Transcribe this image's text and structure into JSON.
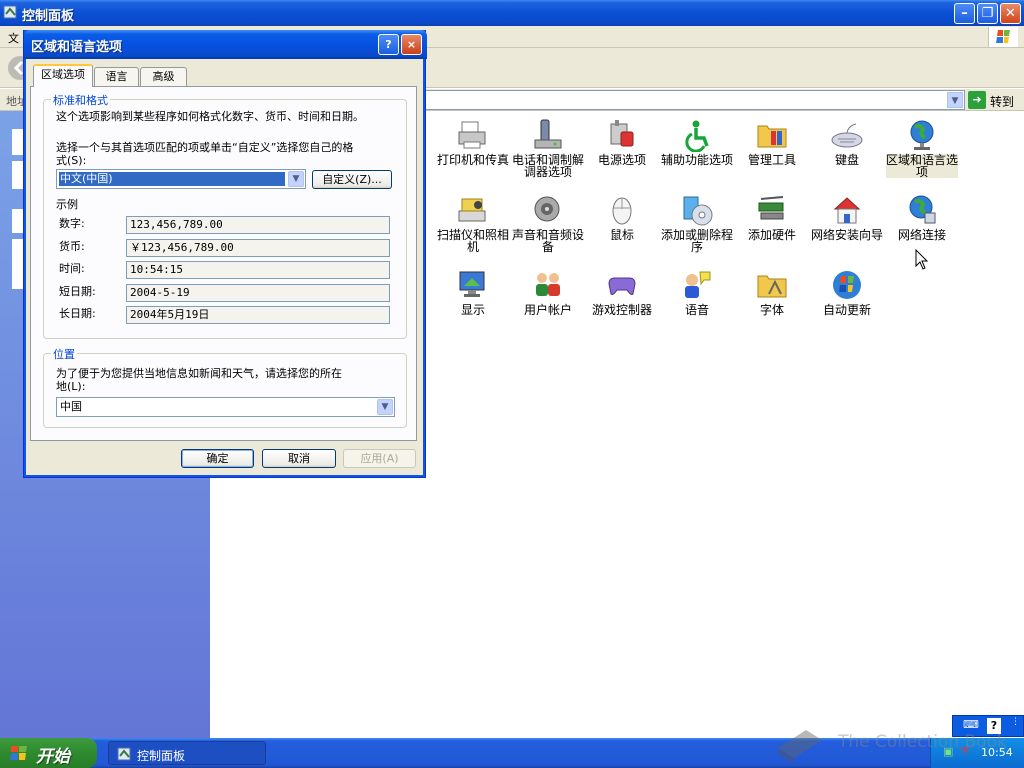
{
  "window": {
    "title": "控制面板"
  },
  "menubar": {
    "file": "文"
  },
  "addressbar": {
    "label": "地址",
    "go_label": "转到"
  },
  "control_panel_items": [
    {
      "label": "打印机和传真",
      "icon": "printer-icon"
    },
    {
      "label": "电话和调制解调器选项",
      "icon": "phone-modem-icon"
    },
    {
      "label": "电源选项",
      "icon": "power-options-icon"
    },
    {
      "label": "辅助功能选项",
      "icon": "accessibility-icon"
    },
    {
      "label": "管理工具",
      "icon": "admin-tools-icon"
    },
    {
      "label": "键盘",
      "icon": "keyboard-icon"
    },
    {
      "label": "区域和语言选项",
      "icon": "globe-icon"
    },
    {
      "label": "扫描仪和照相机",
      "icon": "scanner-icon"
    },
    {
      "label": "声音和音频设备",
      "icon": "speaker-icon"
    },
    {
      "label": "鼠标",
      "icon": "mouse-icon"
    },
    {
      "label": "添加或删除程序",
      "icon": "add-remove-icon"
    },
    {
      "label": "添加硬件",
      "icon": "add-hardware-icon"
    },
    {
      "label": "网络安装向导",
      "icon": "network-wizard-icon"
    },
    {
      "label": "网络连接",
      "icon": "network-connections-icon"
    },
    {
      "label": "显示",
      "icon": "display-icon"
    },
    {
      "label": "用户帐户",
      "icon": "user-accounts-icon"
    },
    {
      "label": "游戏控制器",
      "icon": "game-controller-icon"
    },
    {
      "label": "语音",
      "icon": "speech-icon"
    },
    {
      "label": "字体",
      "icon": "fonts-icon"
    },
    {
      "label": "自动更新",
      "icon": "windows-update-icon"
    }
  ],
  "dialog": {
    "title": "区域和语言选项",
    "help": "?",
    "close": "×",
    "tabs": [
      "区域选项",
      "语言",
      "高级"
    ],
    "standards": {
      "group_title": "标准和格式",
      "desc": "这个选项影响到某些程序如何格式化数字、货币、时间和日期。",
      "select_text_1": "选择一个与其首选项匹配的项或单击“自定义”选择您自己的格",
      "select_text_2": "式(S):",
      "locale_value": "中文(中国)",
      "customize_button": "自定义(Z)...",
      "examples_label": "示例",
      "examples": [
        {
          "label": "数字:",
          "value": "123,456,789.00"
        },
        {
          "label": "货币:",
          "value": "￥123,456,789.00"
        },
        {
          "label": "时间:",
          "value": "10:54:15"
        },
        {
          "label": "短日期:",
          "value": "2004-5-19"
        },
        {
          "label": "长日期:",
          "value": "2004年5月19日"
        }
      ]
    },
    "location": {
      "group_title": "位置",
      "desc_1": "为了便于为您提供当地信息如新闻和天气，请选择您的所在",
      "desc_2": "地(L):",
      "value": "中国"
    },
    "buttons": {
      "ok": "确定",
      "cancel": "取消",
      "apply": "应用(A)"
    }
  },
  "taskbar": {
    "start_label": "开始",
    "task_label": "控制面板",
    "clock": "10:54"
  },
  "watermark": "The Collection Book",
  "colors": {
    "title_blue": "#0a4fd6",
    "taskbar_blue": "#245edc",
    "start_green": "#2f8a2f",
    "dialog_bg": "#ece9d8"
  }
}
